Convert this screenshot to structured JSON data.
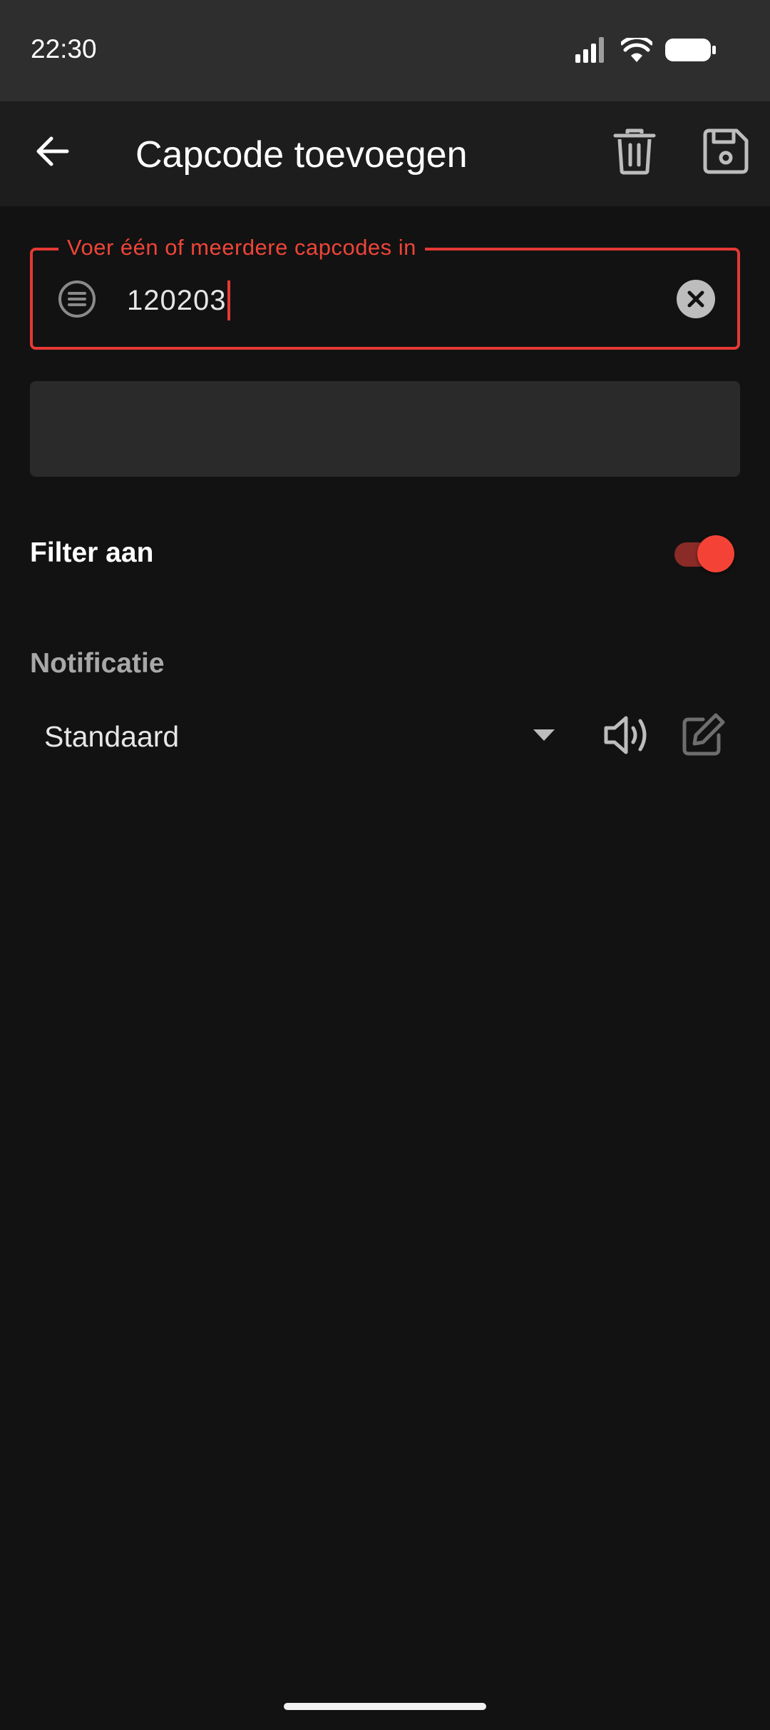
{
  "status_bar": {
    "time": "22:30",
    "icons": [
      "signal-icon",
      "wifi-icon",
      "battery-icon"
    ]
  },
  "app_bar": {
    "title": "Capcode toevoegen",
    "icons": [
      "back-arrow-icon",
      "trash-icon",
      "floppy-disk-icon"
    ]
  },
  "capcode_field": {
    "label": "Voer één of meerdere capcodes in",
    "value": "120203",
    "lead_icon": "list-circle-icon",
    "clear_icon": "clear-circle-icon",
    "state": "focused"
  },
  "filter": {
    "label": "Filter aan",
    "enabled": true
  },
  "notification": {
    "section_title": "Notificatie",
    "selected_option": "Standaard",
    "icons": [
      "dropdown-arrow-icon",
      "speaker-icon",
      "edit-pencil-icon"
    ]
  },
  "colors": {
    "accent": "#e53935",
    "background": "#121212",
    "app_bar": "#1d1d1d",
    "status_bar": "#2e2e2e",
    "panel": "#2a2a2a"
  }
}
